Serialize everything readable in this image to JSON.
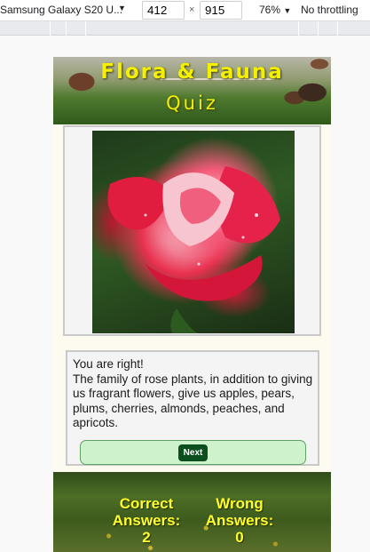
{
  "devtools": {
    "device_name": "Samsung Galaxy S20 U...",
    "width_value": "412",
    "height_value": "915",
    "times_symbol": "×",
    "zoom": "76%",
    "throttle": "No throttling",
    "caret": "▼"
  },
  "header": {
    "title": "Flora & Fauna",
    "subtitle": "Quiz"
  },
  "feedback": {
    "line1": "You are right!",
    "body": "The family of rose plants, in addition to giving us fragrant flowers, give us apples, pears, plums, cherries, almonds, peaches, and apricots."
  },
  "controls": {
    "next_label": "Next"
  },
  "scores": {
    "correct_label": "Correct Answers:",
    "correct_value": "2",
    "wrong_label": "Wrong Answers:",
    "wrong_value": "0"
  },
  "colors": {
    "title_yellow": "#f4f000",
    "next_button": "#0a4f1c",
    "next_bar": "#cdf2cc"
  }
}
